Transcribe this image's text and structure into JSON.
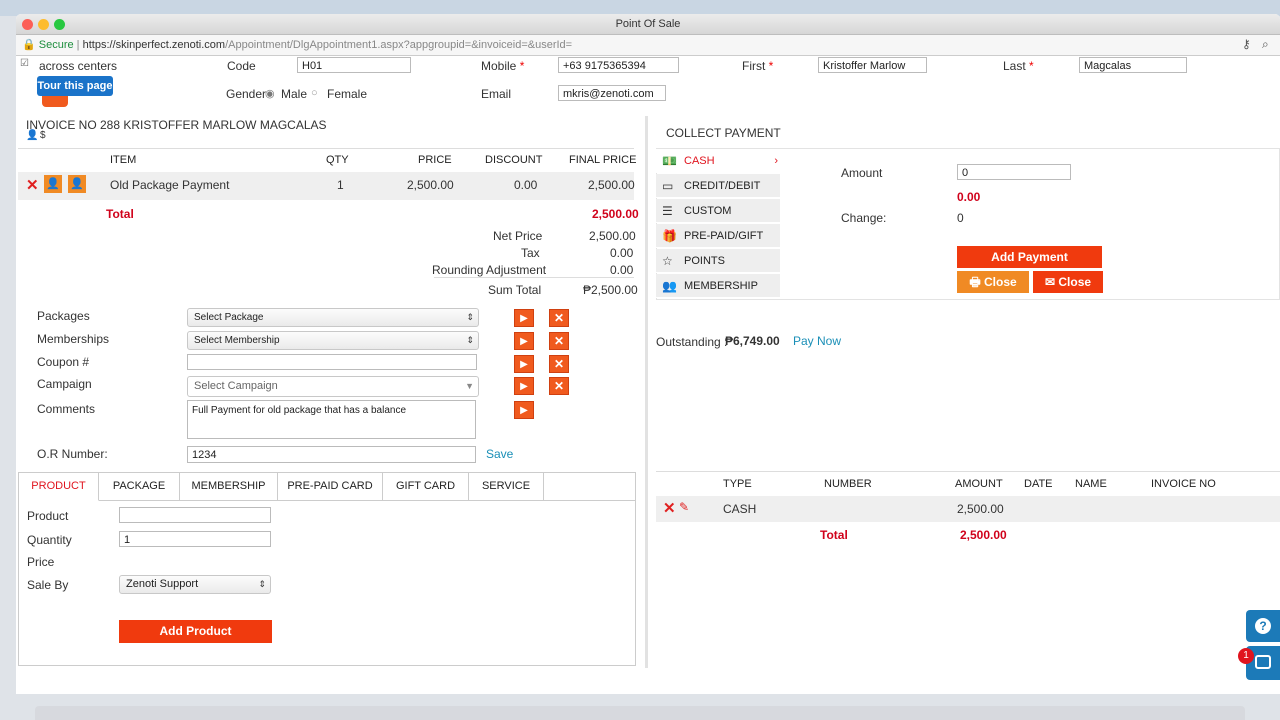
{
  "window": {
    "title": "Point Of Sale"
  },
  "address": {
    "secure": "Secure",
    "sep": " | ",
    "url_main": "https://skinperfect.zenoti.com",
    "url_path": "/Appointment/DlgAppointment1.aspx?appgroupid=&invoiceid=&userId="
  },
  "top": {
    "across_centers": "across centers",
    "tour": "Tour this page",
    "code_label": "Code",
    "code_value": "H01",
    "mobile_label": "Mobile",
    "mobile_value": "+63 9175365394",
    "first_label": "First",
    "first_value": "Kristoffer Marlow",
    "last_label": "Last",
    "last_value": "Magcalas",
    "gender_label": "Gender",
    "male": "Male",
    "female": "Female",
    "email_label": "Email",
    "email_value": "mkris@zenoti.com",
    "required": "*"
  },
  "invoice": {
    "title": "INVOICE NO 288  KRISTOFFER MARLOW MAGCALAS",
    "currency": "$",
    "headers": {
      "item": "ITEM",
      "qty": "QTY",
      "price": "PRICE",
      "discount": "DISCOUNT",
      "final": "FINAL PRICE"
    },
    "row": {
      "item": "Old Package Payment",
      "qty": "1",
      "price": "2,500.00",
      "discount": "0.00",
      "final": "2,500.00"
    },
    "total_label": "Total",
    "total_value": "2,500.00",
    "net_label": "Net Price",
    "net_value": "2,500.00",
    "tax_label": "Tax",
    "tax_value": "0.00",
    "round_label": "Rounding Adjustment",
    "round_value": "0.00",
    "sum_label": "Sum Total",
    "sum_value": "₱2,500.00"
  },
  "form": {
    "packages_label": "Packages",
    "packages_value": "Select Package",
    "memberships_label": "Memberships",
    "memberships_value": "Select Membership",
    "coupon_label": "Coupon #",
    "campaign_label": "Campaign",
    "campaign_value": "Select Campaign",
    "comments_label": "Comments",
    "comments_value": "Full Payment for old package that has a balance",
    "or_label": "O.R Number:",
    "or_value": "1234",
    "save": "Save"
  },
  "tabs": [
    "PRODUCT",
    "PACKAGE",
    "MEMBERSHIP",
    "PRE-PAID CARD",
    "GIFT CARD",
    "SERVICE"
  ],
  "product": {
    "product_label": "Product",
    "quantity_label": "Quantity",
    "quantity_value": "1",
    "price_label": "Price",
    "saleby_label": "Sale By",
    "saleby_value": "Zenoti Support",
    "add_button": "Add Product"
  },
  "payment": {
    "title": "COLLECT PAYMENT",
    "methods": [
      "CASH",
      "CREDIT/DEBIT",
      "CUSTOM",
      "PRE-PAID/GIFT",
      "POINTS",
      "MEMBERSHIP"
    ],
    "amount_label": "Amount",
    "amount_value": "0",
    "amount_due": "0.00",
    "change_label": "Change:",
    "change_value": "0",
    "add_payment": "Add Payment",
    "close1": "Close",
    "close2": "Close",
    "outstanding_label": "Outstanding :",
    "outstanding_value": "₱6,749.00",
    "pay_now": "Pay Now"
  },
  "payments_table": {
    "headers": {
      "type": "TYPE",
      "number": "NUMBER",
      "amount": "AMOUNT",
      "date": "DATE",
      "name": "NAME",
      "invoice": "INVOICE NO"
    },
    "row": {
      "type": "CASH",
      "amount": "2,500.00"
    },
    "total_label": "Total",
    "total_value": "2,500.00"
  },
  "chat": {
    "badge": "1"
  },
  "colors": {
    "accent": "#f05a1e",
    "red": "#d0021b",
    "link": "#1a8fb7",
    "help": "#1c7ab8"
  }
}
